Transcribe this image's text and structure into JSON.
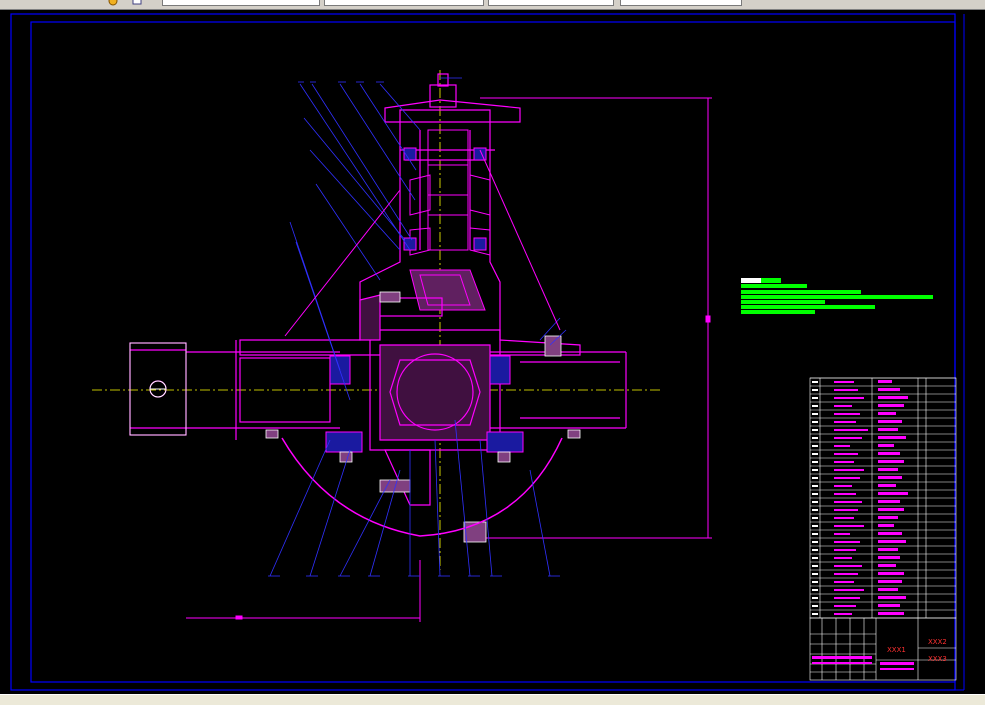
{
  "window": {
    "toolbar_fields": [
      "",
      "",
      "",
      "",
      "",
      ""
    ],
    "layer_dropdown": "",
    "colors": {
      "canvas": "#000000",
      "chrome": "#d4d0c8",
      "frame": "#0000ff",
      "geometry": "#ff00ff",
      "leader": "#2020ff",
      "note_text": "#00ff00",
      "centerline": "#ffff00"
    }
  },
  "drawing": {
    "title": "XXX1",
    "code_top": "XXX2",
    "code_bottom": "XXX3",
    "dimension_overall": "",
    "dimension_bottom": ""
  },
  "icons": [
    "undo-icon",
    "layer-icon"
  ]
}
